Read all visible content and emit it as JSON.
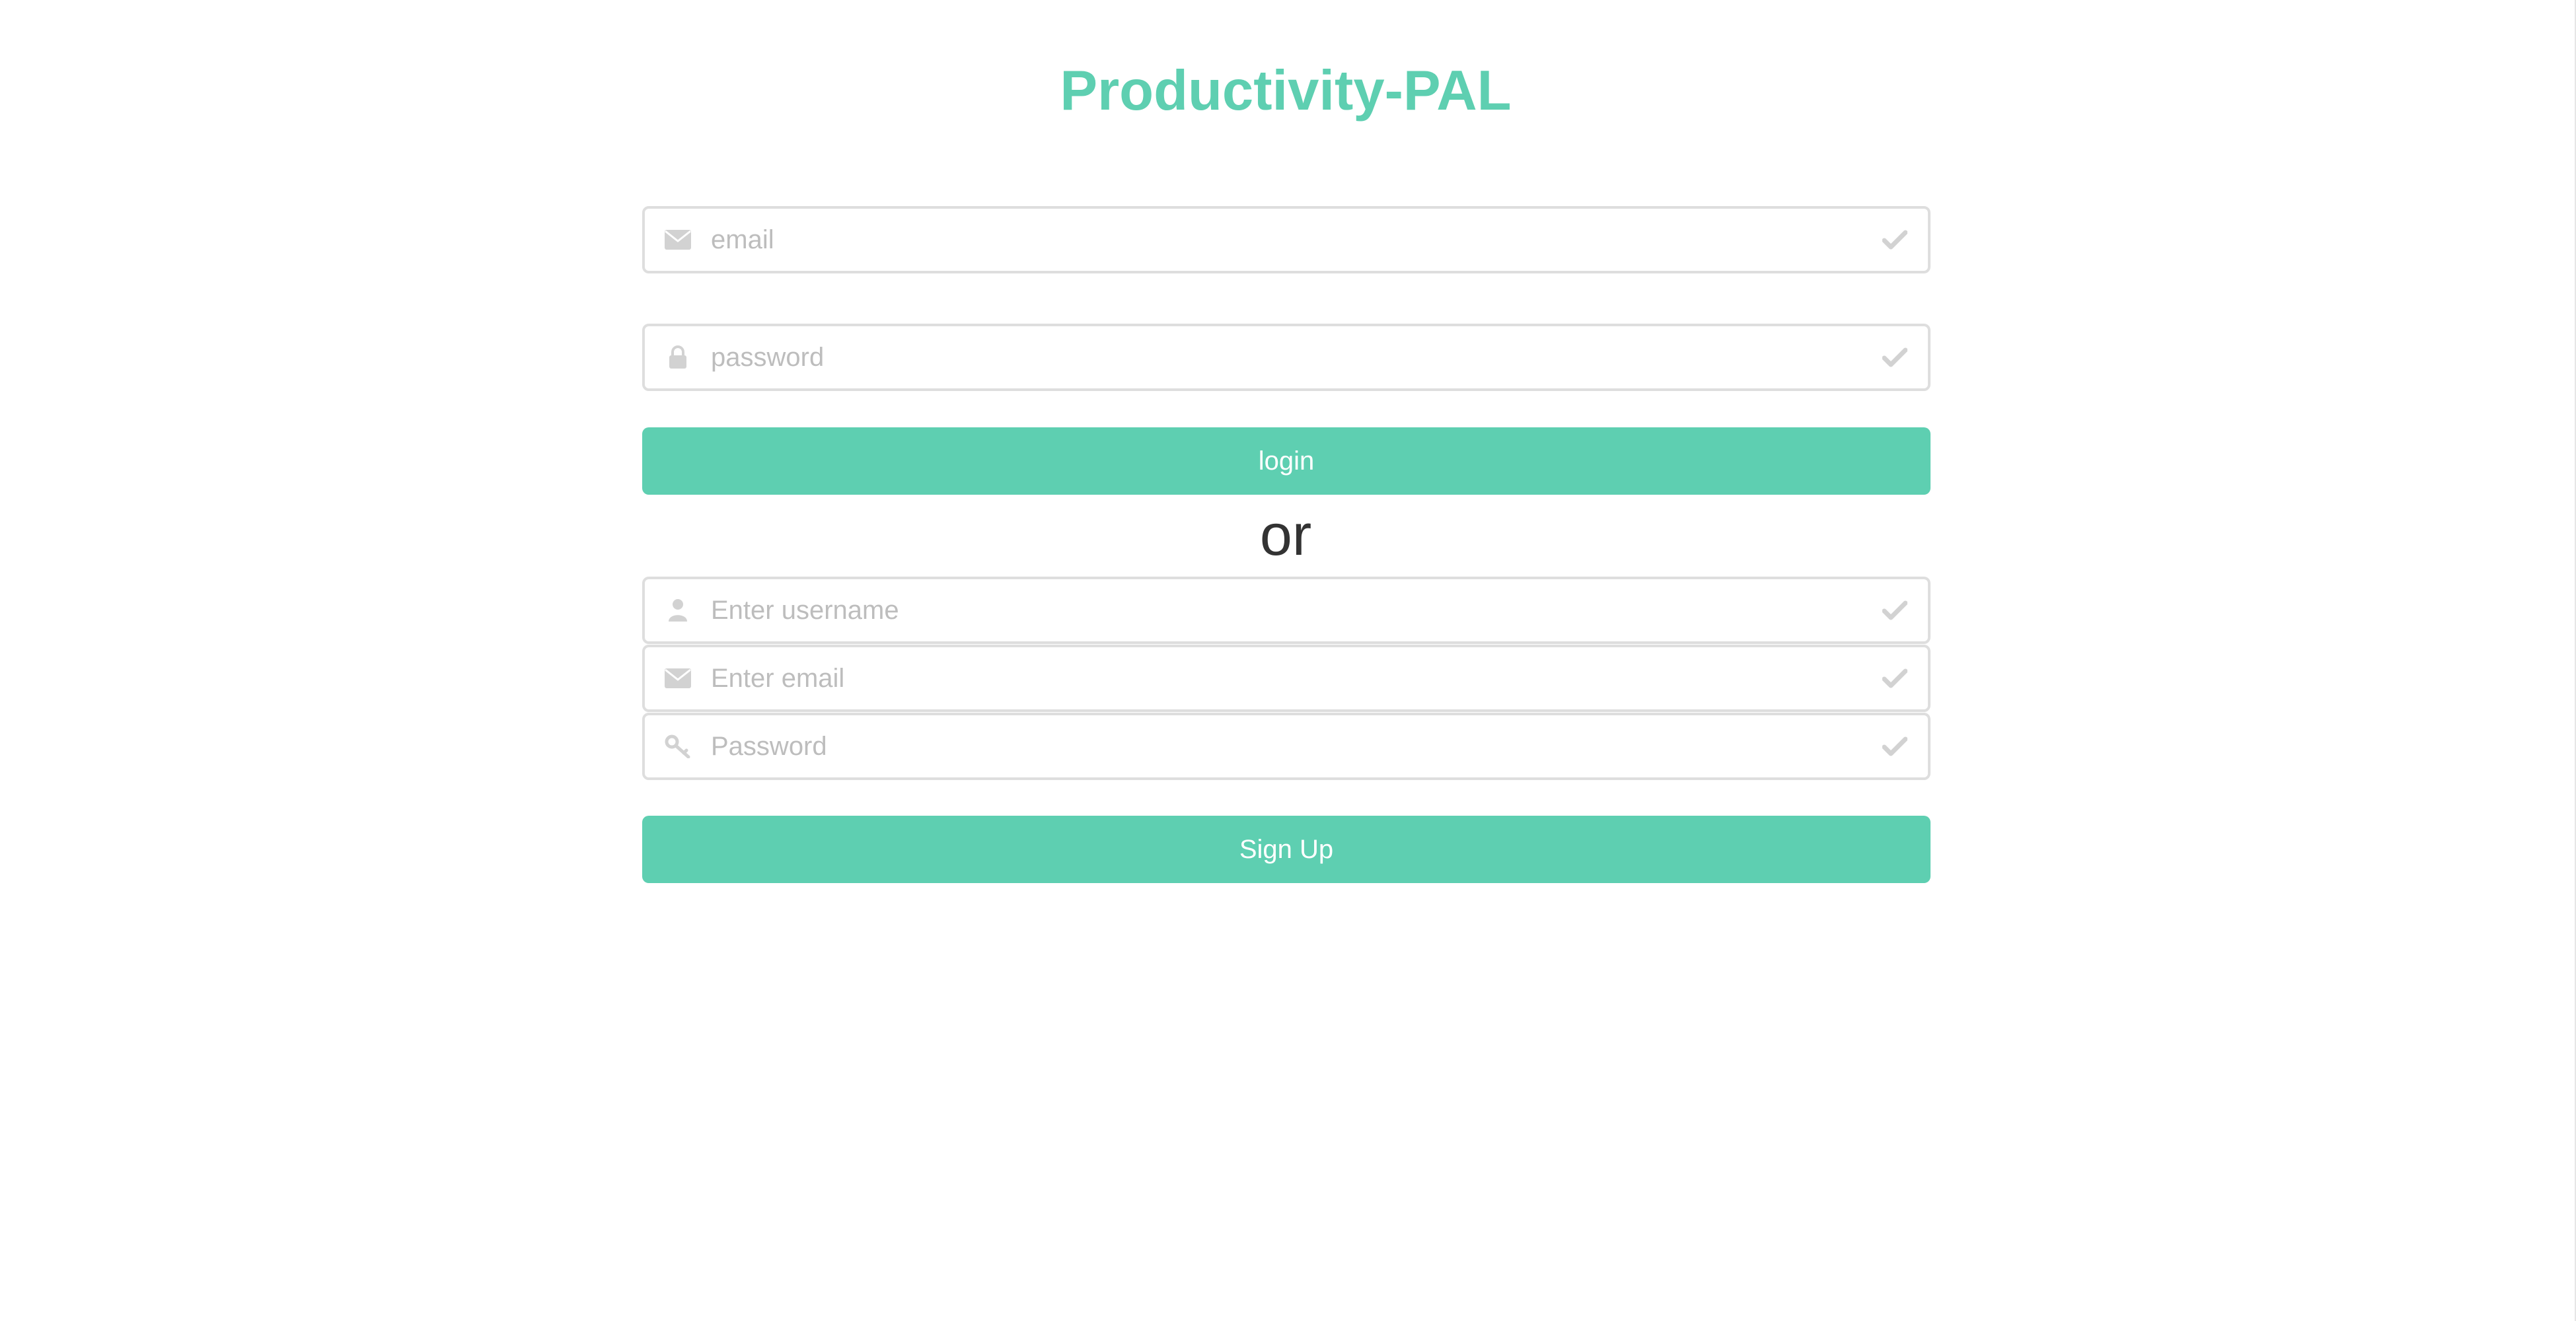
{
  "app": {
    "title": "Productivity-PAL"
  },
  "login": {
    "email_placeholder": "email",
    "password_placeholder": "password",
    "submit_label": "login"
  },
  "divider": {
    "text": "or"
  },
  "signup": {
    "username_placeholder": "Enter username",
    "email_placeholder": "Enter email",
    "password_placeholder": "Password",
    "submit_label": "Sign Up"
  },
  "icons": {
    "email": "envelope-icon",
    "password": "lock-icon",
    "username": "user-icon",
    "signup_password": "key-icon",
    "valid": "check-icon"
  },
  "colors": {
    "accent": "#5ecfb1",
    "border": "#dedede",
    "icon": "#d2d2d2",
    "placeholder": "#bdbdbd",
    "text_dark": "#333333",
    "background": "#ffffff"
  }
}
